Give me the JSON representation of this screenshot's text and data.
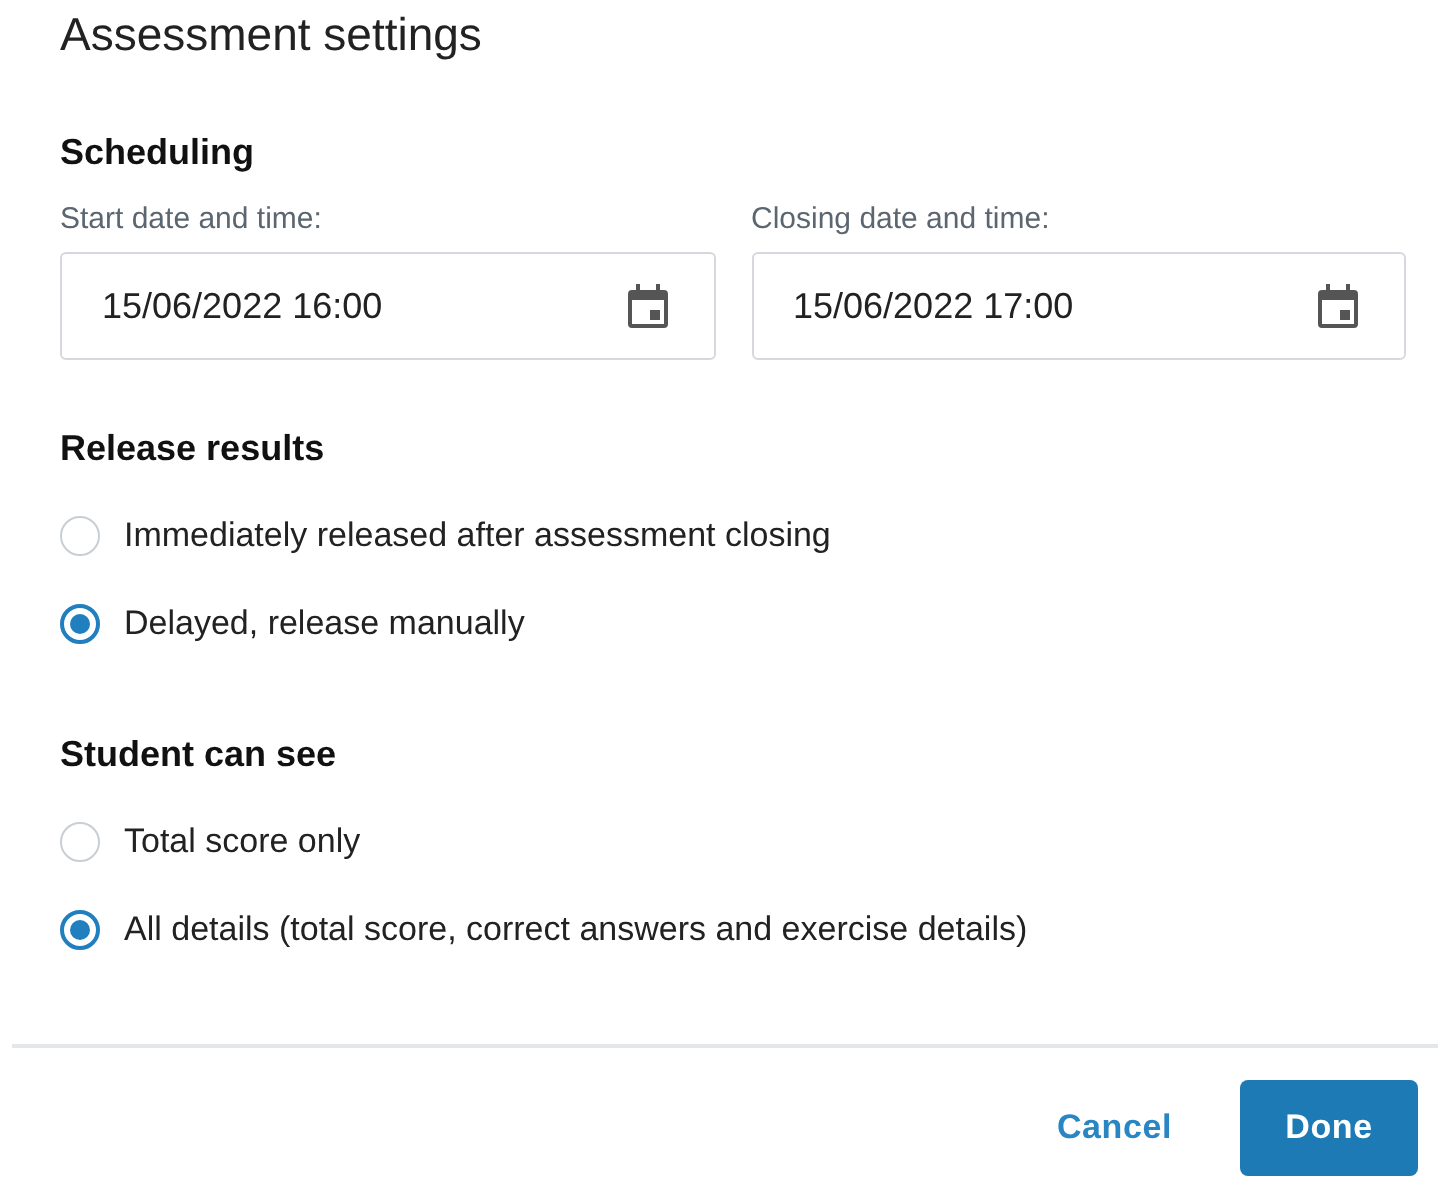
{
  "dialog": {
    "title": "Assessment settings"
  },
  "scheduling": {
    "heading": "Scheduling",
    "fields": [
      {
        "label": "Start date and time:",
        "value": "15/06/2022 16:00"
      },
      {
        "label": "Closing date and time:",
        "value": "15/06/2022 17:00"
      }
    ]
  },
  "groups": [
    {
      "heading": "Release results",
      "options": [
        {
          "label": "Immediately released after assessment closing",
          "selected": false
        },
        {
          "label": "Delayed, release manually",
          "selected": true
        }
      ]
    },
    {
      "heading": "Student can see",
      "options": [
        {
          "label": "Total score only",
          "selected": false
        },
        {
          "label": "All details (total score, correct answers and exercise details)",
          "selected": true
        }
      ]
    }
  ],
  "buttons": [
    {
      "label": "Cancel",
      "kind": "text"
    },
    {
      "label": "Done",
      "kind": "primary"
    }
  ]
}
